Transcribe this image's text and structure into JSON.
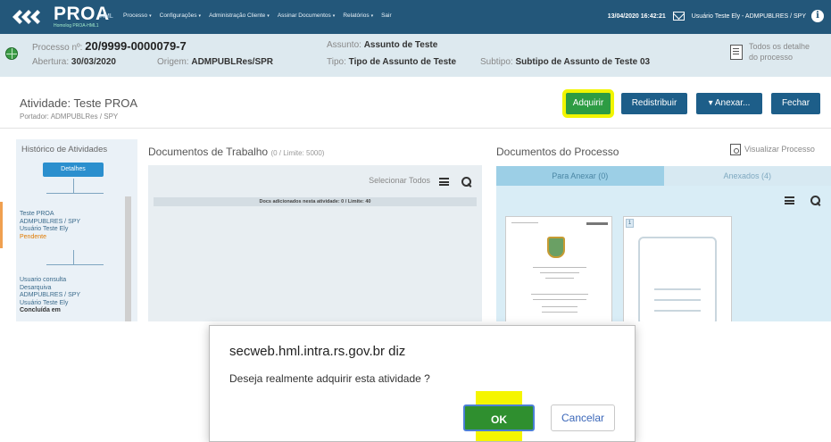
{
  "topbar": {
    "logo": "PROA",
    "logo_small": "HML",
    "logo_sub": "Homolog PROA-HML1",
    "menu": [
      "Processo",
      "Configurações",
      "Administração Cliente",
      "Assinar Documentos",
      "Relatórios",
      "Sair"
    ],
    "datetime": "13/04/2020 16:42:21",
    "user": "Usuário Teste Ely - ADMPUBLRES / SPY",
    "colors": {
      "bar": "#23577a",
      "highlight": "#f1f500"
    }
  },
  "process": {
    "numero_label": "Processo nº:",
    "numero": "20/9999-0000079-7",
    "abertura_label": "Abertura:",
    "abertura": "30/03/2020",
    "origem_label": "Origem:",
    "origem": "ADMPUBLRes/SPR",
    "assunto_label": "Assunto:",
    "assunto": "Assunto de Teste",
    "tipo_label": "Tipo:",
    "tipo": "Tipo de Assunto de Teste",
    "subtipo_label": "Subtipo:",
    "subtipo": "Subtipo de Assunto de Teste 03",
    "todos_line1": "Todos os detalhe",
    "todos_line2": "do processo"
  },
  "activity": {
    "title": "Atividade: Teste PROA",
    "portador": "Portador: ADMPUBLRes / SPY",
    "buttons": {
      "adquirir": "Adquirir",
      "redistribuir": "Redistribuir",
      "anexar": "Anexar...",
      "fechar": "Fechar"
    }
  },
  "historico": {
    "title": "Histórico de Atividades",
    "detalhes": "Detalhes",
    "entry1": {
      "l1": "Teste PROA",
      "l2": "ADMPUBLRES / SPY",
      "l3": "Usuário Teste Ely",
      "status": "Pendente"
    },
    "entry2": {
      "l1": "Usuario consulta",
      "l2": "Desarquiva",
      "l3": "ADMPUBLRES / SPY",
      "l4": "Usuário Teste Ely",
      "status": "Concluída em"
    }
  },
  "trabalho": {
    "title": "Documentos de Trabalho",
    "limit": "(0 / Limite: 5000)",
    "selecionar": "Selecionar Todos",
    "docs_added": "Docs adicionados nesta atividade: 0 / Limite: 40"
  },
  "processo_docs": {
    "title": "Documentos do Processo",
    "visualizar": "Visualizar Processo",
    "tab_anexar": "Para Anexar (0)",
    "tab_anexados": "Anexados (4)",
    "badge": "1"
  },
  "dialog": {
    "title": "secweb.hml.intra.rs.gov.br diz",
    "message": "Deseja realmente adquirir esta atividade ?",
    "ok": "OK",
    "cancel": "Cancelar"
  }
}
